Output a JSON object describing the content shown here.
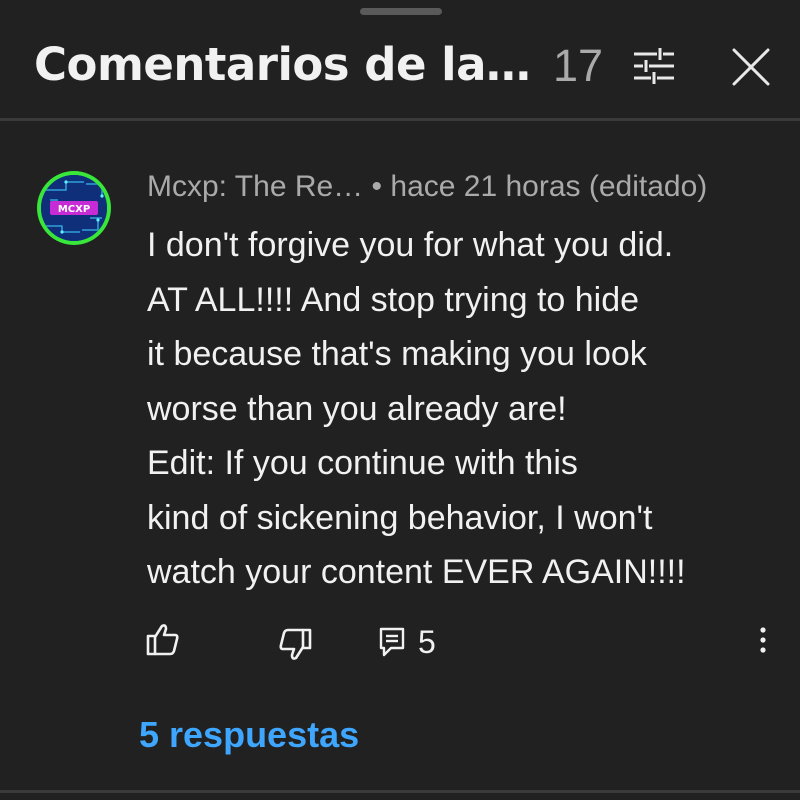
{
  "header": {
    "title": "Comentarios de la…",
    "count": "17",
    "filter_icon": "tune-icon",
    "close_icon": "close-icon"
  },
  "comment": {
    "author": "Mcxp: The Re…",
    "separator": "•",
    "time": "hace 21 horas (editado)",
    "avatar_text": "MCXP",
    "text_lines": [
      "I don't forgive you for what you did.",
      "AT ALL!!!! And stop trying to hide",
      "it because that's making you look",
      "worse than you already are!",
      "Edit: If you continue with this",
      "kind of sickening behavior, I won't",
      "watch your content EVER AGAIN!!!!"
    ],
    "reply_count": "5"
  },
  "replies_link": "5 respuestas",
  "colors": {
    "background": "#212121",
    "link": "#3ea6ff",
    "avatar_ring": "#39e63a",
    "secondary_text": "#aaaaaa"
  },
  "icons": {
    "like": "thumb-up-icon",
    "dislike": "thumb-down-icon",
    "reply": "comment-reply-icon",
    "more": "more-vert-icon"
  }
}
